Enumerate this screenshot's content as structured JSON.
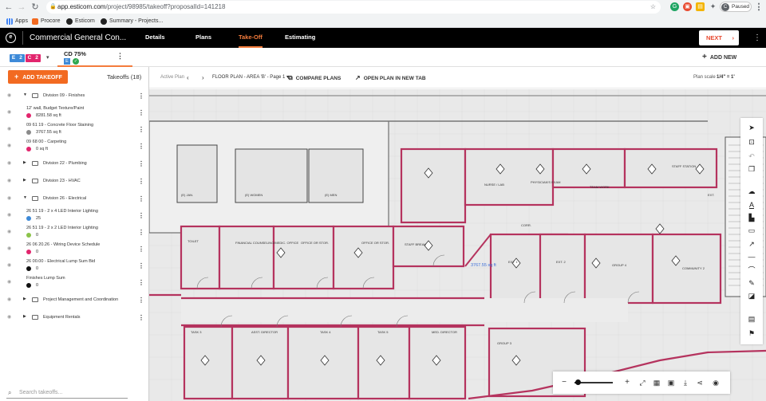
{
  "browser": {
    "url_host": "app.esticom.com",
    "url_path": "/project/98985/takeoff?proposalId=141218",
    "bookmarks": [
      "Apps",
      "Procore",
      "Esticom",
      "Summary - Projects..."
    ],
    "profile_label": "Paused",
    "profile_initial": "C"
  },
  "appbar": {
    "project_title": "Commercial General Con...",
    "tabs": [
      "Details",
      "Plans",
      "Take-Off",
      "Estimating"
    ],
    "active_tab": "Take-Off",
    "next_label": "NEXT"
  },
  "subbar": {
    "badges": [
      {
        "label": "E",
        "color": "#3d8ad8"
      },
      {
        "label": "2",
        "color": "#3d8ad8"
      },
      {
        "label": "C",
        "color": "#e2256d"
      },
      {
        "label": "2",
        "color": "#e2256d"
      }
    ],
    "plan_set": "CD 75%",
    "plan_set_badge": "E",
    "add_new_label": "ADD NEW"
  },
  "sidebar": {
    "add_takeoff_label": "ADD TAKEOFF",
    "takeoffs_count": "Takeoffs (18)",
    "search_placeholder": "Search takeoffs...",
    "rows": [
      {
        "type": "division",
        "label": "Division 09 - Finishes",
        "expanded": true
      },
      {
        "type": "item",
        "label": "12' wall, Budget Texture/Paint",
        "qty": "8281.58 sq ft",
        "color": "#e2256d"
      },
      {
        "type": "item",
        "label": "09 61 19 - Concrete Floor Staining",
        "qty": "3767.55 sq ft",
        "color": "#8a8a8a"
      },
      {
        "type": "item",
        "label": "09 68 00 - Carpeting",
        "qty": "0 sq ft",
        "color": "#e2256d"
      },
      {
        "type": "division",
        "label": "Division 22 - Plumbing",
        "expanded": false
      },
      {
        "type": "division",
        "label": "Division 23 - HVAC",
        "expanded": false
      },
      {
        "type": "division",
        "label": "Division 26 - Electrical",
        "expanded": true
      },
      {
        "type": "item",
        "label": "26 51 19 - 2 x 4 LED Interior Lighting",
        "qty": "25",
        "color": "#3d8ad8"
      },
      {
        "type": "item",
        "label": "26 51 19 - 2 x 2 LED Interior Lighting",
        "qty": "0",
        "color": "#8bc34a"
      },
      {
        "type": "item",
        "label": "26 06 20.26 - Wiring Device Schedule",
        "qty": "0",
        "color": "#e2256d"
      },
      {
        "type": "item",
        "label": "26 00.00 - Electrical Lump Sum Bid",
        "qty": "0",
        "color": "#111111"
      },
      {
        "type": "item",
        "label": "Finishes Lump Sum",
        "qty": "0",
        "color": "#111111"
      },
      {
        "type": "division",
        "label": "Project Management and Coordination",
        "expanded": false
      },
      {
        "type": "division",
        "label": "Equipment Rentals",
        "expanded": false
      }
    ]
  },
  "plan": {
    "active_plan_label": "Active Plan",
    "plan_name": "FLOOR PLAN - AREA 'B' - Page 1",
    "compare_label": "COMPARE PLANS",
    "open_tab_label": "OPEN PLAN IN NEW TAB",
    "scale_label": "Plan scale",
    "scale_value": "1/4\" = 1'",
    "measure_label": "3767.55 sq ft",
    "highlight_color": "#b5335e",
    "rooms": [
      "(E) JAN.",
      "(E) WOMEN",
      "(E) MEN",
      "TOILET",
      "FINANCIAL COUNSELING/MEDIC. OFFICE",
      "OFFICE OR STOR.",
      "OFFICE OR STOR.",
      "STAFF BREAK",
      "NURSE / LAB",
      "PHYSICIAN'S EXAM",
      "CORR.",
      "TEAM WORK",
      "STAFF STATION",
      "EXT.",
      "EXT. 1",
      "EXT. 2",
      "GROUP 4",
      "COMMUNITY 2",
      "TASK 3",
      "ASST. DIRECTOR",
      "TASK 4",
      "TASK 5",
      "MED. DIRECTOR",
      "GROUP 3"
    ]
  }
}
